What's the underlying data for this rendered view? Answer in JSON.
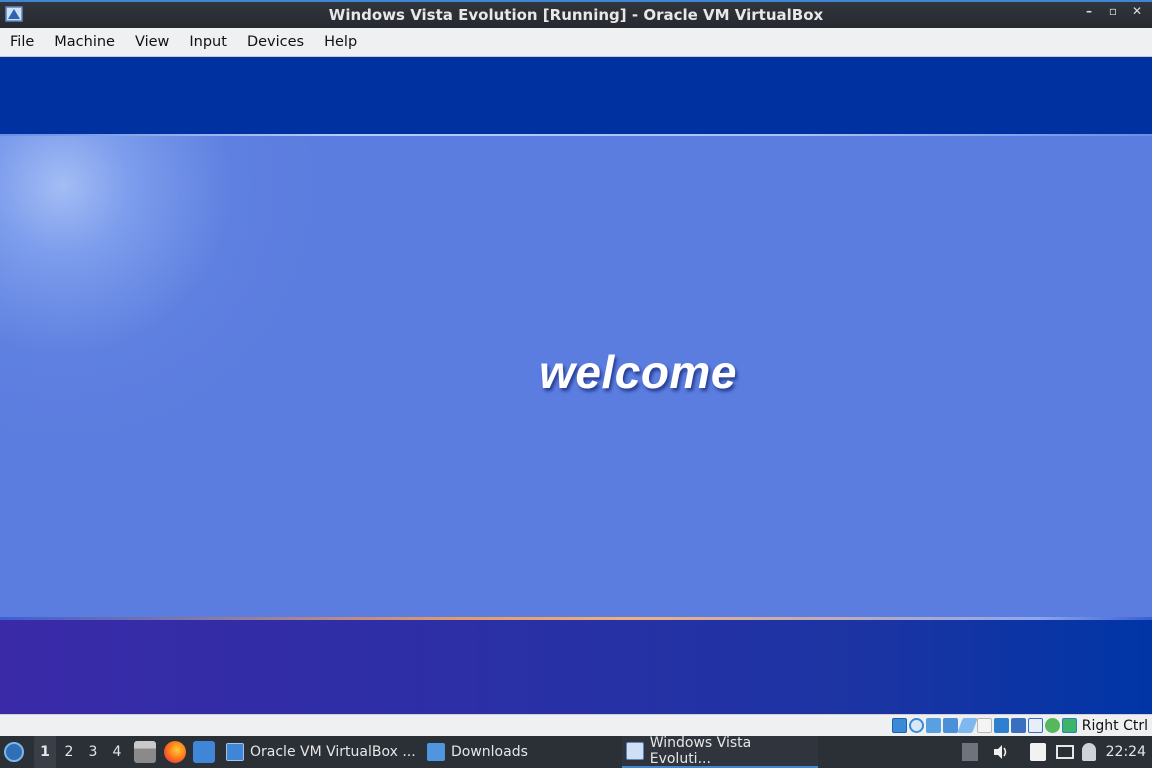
{
  "window": {
    "title": "Windows Vista Evolution [Running] - Oracle VM VirtualBox",
    "minimize": "–",
    "restore": "▫",
    "close": "✕"
  },
  "menubar": [
    "File",
    "Machine",
    "View",
    "Input",
    "Devices",
    "Help"
  ],
  "vm": {
    "welcome_text": "welcome"
  },
  "statusbar": {
    "host_key": "Right Ctrl",
    "icons": [
      "hard-disk-icon",
      "optical-drive-icon",
      "audio-icon",
      "network-icon",
      "usb-icon",
      "shared-folders-icon",
      "display-icon",
      "video-capture-icon",
      "virtualization-icon",
      "mouse-integration-icon",
      "keyboard-icon"
    ]
  },
  "taskbar": {
    "workspaces": [
      "1",
      "2",
      "3",
      "4"
    ],
    "active_workspace": "1",
    "tasks": [
      {
        "label": "Oracle VM VirtualBox ...",
        "icon": "virtualbox-icon"
      },
      {
        "label": "Downloads",
        "icon": "folder-icon"
      },
      {
        "label": "Windows Vista Evoluti...",
        "icon": "virtualbox-vm-icon",
        "current": true
      }
    ],
    "clock": "22:24"
  },
  "colors": {
    "vm_top": "#0031a0",
    "vm_mid": "#5b7ddf",
    "taskbar": "#2b2f36",
    "accent": "#3f86d6"
  }
}
